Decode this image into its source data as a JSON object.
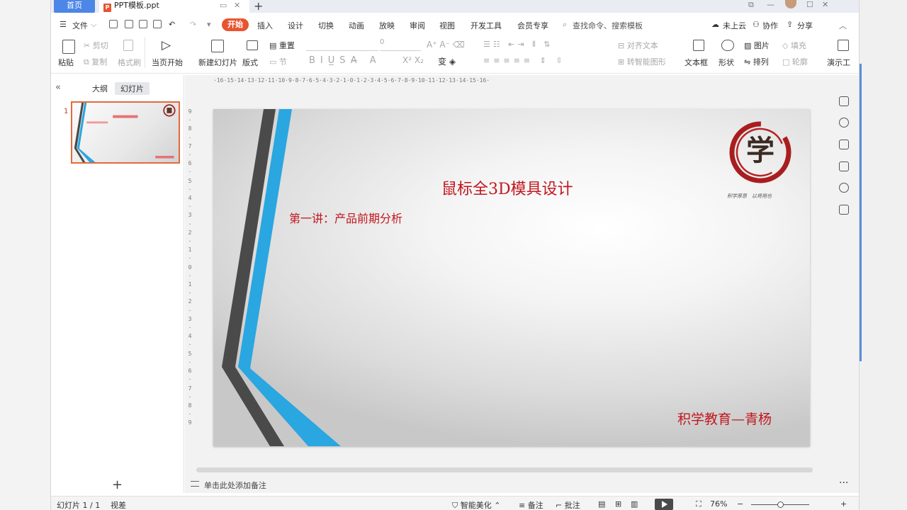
{
  "window": {
    "home_tab": "首页",
    "doc_tab": "PPT模板.ppt",
    "doc_icon": "P",
    "new_tab": "+",
    "controls": [
      "⧉",
      "—",
      "☐",
      "✕"
    ]
  },
  "menu": {
    "file": "文件",
    "tabs": [
      "开始",
      "插入",
      "设计",
      "切换",
      "动画",
      "放映",
      "审阅",
      "视图",
      "开发工具",
      "会员专享"
    ],
    "search": "查找命令、搜索模板",
    "cloud": "未上云",
    "collab": "协作",
    "share": "分享"
  },
  "ribbon": {
    "paste": "粘贴",
    "cut": "剪切",
    "copy": "复制",
    "format_painter": "格式刷",
    "start_from_current": "当页开始",
    "new_slide": "新建幻灯片",
    "layout": "版式",
    "reset": "重置",
    "section": "节",
    "font_size": "0",
    "align_text": "对齐文本",
    "smartart": "转智能图形",
    "textbox": "文本框",
    "shape": "形状",
    "picture": "图片",
    "arrange": "排列",
    "fill": "填充",
    "outline": "轮廓",
    "present": "演示工"
  },
  "panel": {
    "collapse": "«",
    "tab_outline": "大纲",
    "tab_slides": "幻灯片",
    "slide_number": "1",
    "add_slide": "+"
  },
  "ruler": {
    "horizontal": "·16·15·14·13·12·11·10·9·8·7·6·5·4·3·2·1·0·1·2·3·4·5·6·7·8·9·10·11·12·13·14·15·16·",
    "vertical": [
      "9",
      "·",
      "8",
      "·",
      "7",
      "·",
      "6",
      "·",
      "5",
      "·",
      "4",
      "·",
      "3",
      "·",
      "2",
      "·",
      "1",
      "·",
      "0",
      "·",
      "1",
      "·",
      "2",
      "·",
      "3",
      "·",
      "4",
      "·",
      "5",
      "·",
      "6",
      "·",
      "7",
      "·",
      "8",
      "·",
      "9"
    ]
  },
  "slide": {
    "title": "鼠标全3D模具设计",
    "subtitle": "第一讲：产品前期分析",
    "footer": "积学教育—青杨",
    "logo_char": "学",
    "logo_tagline": "积学厚思　以将用也"
  },
  "notes": {
    "placeholder": "单击此处添加备注"
  },
  "status": {
    "slide_info": "幻灯片 1 / 1",
    "theme": "视差",
    "smart_beautify": "智能美化",
    "notes": "备注",
    "comments": "批注",
    "zoom": "76%",
    "zoom_out": "−",
    "zoom_in": "+"
  },
  "colors": {
    "accent": "#e8542f",
    "title_red": "#c0171e",
    "stripe_blue": "#2aa6e0",
    "stripe_dark": "#4a4a4a",
    "home_tab_blue": "#4c86e6"
  }
}
